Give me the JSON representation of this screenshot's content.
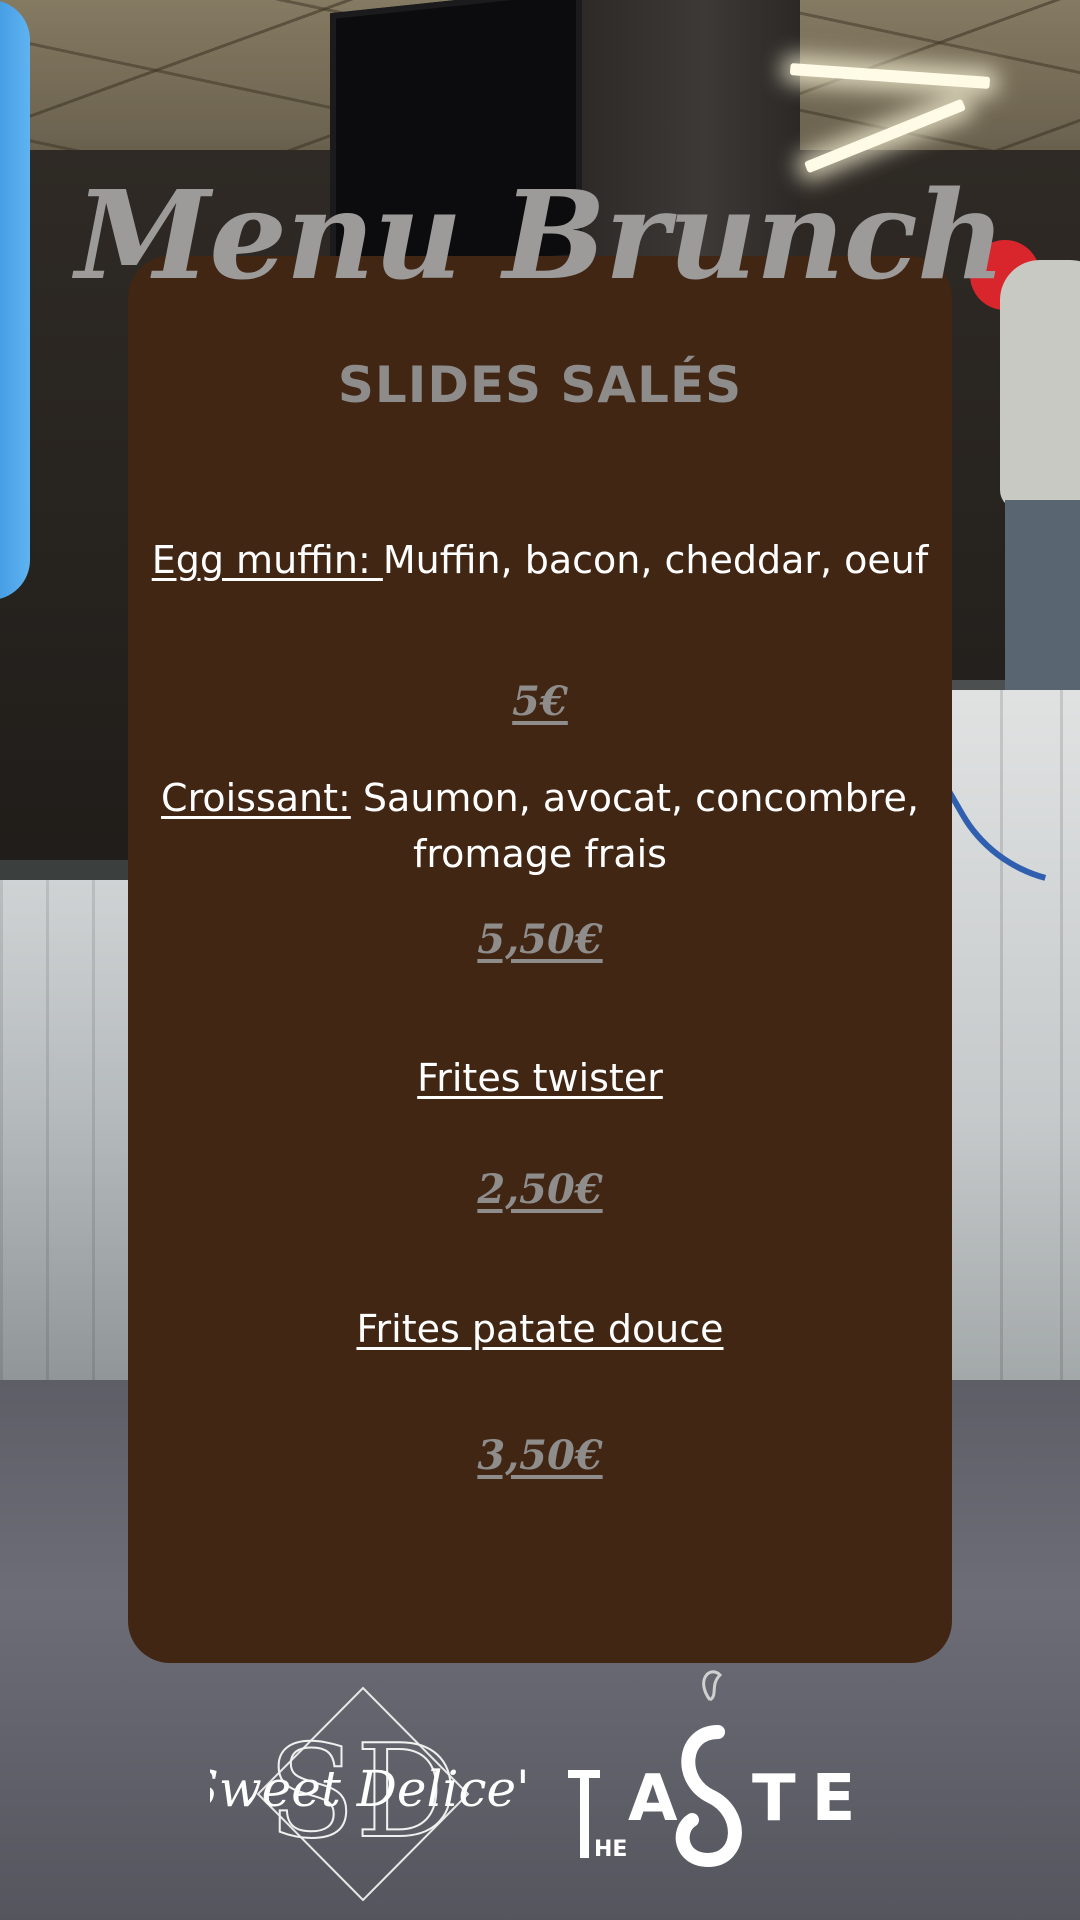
{
  "menu": {
    "title": "Menu Brunch",
    "subtitle": "SLIDES SALÉS",
    "items": [
      {
        "name": "Egg muffin: ",
        "description": "Muffin, bacon, cheddar, oeuf",
        "price": "5€"
      },
      {
        "name": "Croissant:",
        "description": " Saumon, avocat, concombre, fromage frais",
        "price": "5,50€"
      },
      {
        "name": "Frites twister",
        "price": "2,50€"
      },
      {
        "name": "Frites patate douce",
        "price": "3,50€"
      }
    ]
  },
  "logos": {
    "sweet_delices": "Sweet Delice's",
    "sweet_delices_monogram": "SD",
    "the_taste": "THE TASTE"
  },
  "colors": {
    "card": "#422614",
    "title": "#9c9b99",
    "text": "#ffffff",
    "price": "#8e8d8b"
  }
}
